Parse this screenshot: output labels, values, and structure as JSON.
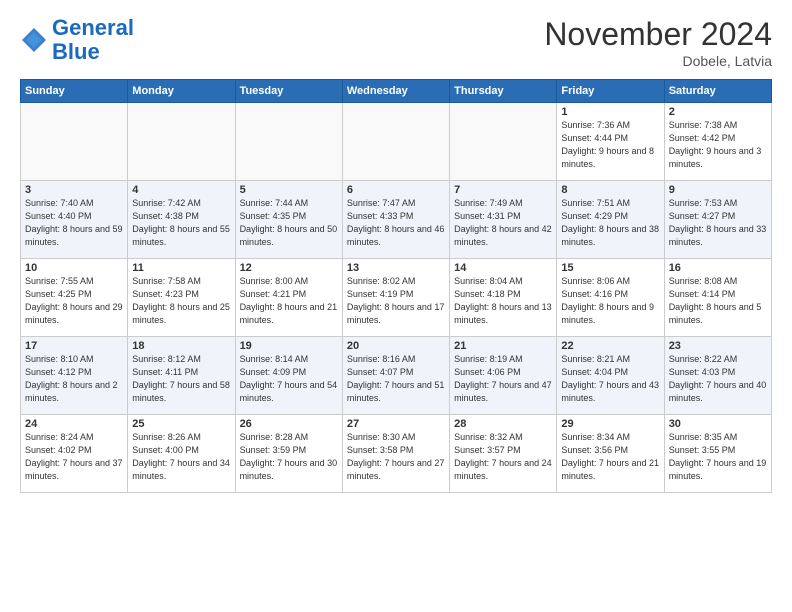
{
  "header": {
    "logo_line1": "General",
    "logo_line2": "Blue",
    "month_title": "November 2024",
    "location": "Dobele, Latvia"
  },
  "weekdays": [
    "Sunday",
    "Monday",
    "Tuesday",
    "Wednesday",
    "Thursday",
    "Friday",
    "Saturday"
  ],
  "weeks": [
    [
      {
        "day": "",
        "info": ""
      },
      {
        "day": "",
        "info": ""
      },
      {
        "day": "",
        "info": ""
      },
      {
        "day": "",
        "info": ""
      },
      {
        "day": "",
        "info": ""
      },
      {
        "day": "1",
        "info": "Sunrise: 7:36 AM\nSunset: 4:44 PM\nDaylight: 9 hours\nand 8 minutes."
      },
      {
        "day": "2",
        "info": "Sunrise: 7:38 AM\nSunset: 4:42 PM\nDaylight: 9 hours\nand 3 minutes."
      }
    ],
    [
      {
        "day": "3",
        "info": "Sunrise: 7:40 AM\nSunset: 4:40 PM\nDaylight: 8 hours\nand 59 minutes."
      },
      {
        "day": "4",
        "info": "Sunrise: 7:42 AM\nSunset: 4:38 PM\nDaylight: 8 hours\nand 55 minutes."
      },
      {
        "day": "5",
        "info": "Sunrise: 7:44 AM\nSunset: 4:35 PM\nDaylight: 8 hours\nand 50 minutes."
      },
      {
        "day": "6",
        "info": "Sunrise: 7:47 AM\nSunset: 4:33 PM\nDaylight: 8 hours\nand 46 minutes."
      },
      {
        "day": "7",
        "info": "Sunrise: 7:49 AM\nSunset: 4:31 PM\nDaylight: 8 hours\nand 42 minutes."
      },
      {
        "day": "8",
        "info": "Sunrise: 7:51 AM\nSunset: 4:29 PM\nDaylight: 8 hours\nand 38 minutes."
      },
      {
        "day": "9",
        "info": "Sunrise: 7:53 AM\nSunset: 4:27 PM\nDaylight: 8 hours\nand 33 minutes."
      }
    ],
    [
      {
        "day": "10",
        "info": "Sunrise: 7:55 AM\nSunset: 4:25 PM\nDaylight: 8 hours\nand 29 minutes."
      },
      {
        "day": "11",
        "info": "Sunrise: 7:58 AM\nSunset: 4:23 PM\nDaylight: 8 hours\nand 25 minutes."
      },
      {
        "day": "12",
        "info": "Sunrise: 8:00 AM\nSunset: 4:21 PM\nDaylight: 8 hours\nand 21 minutes."
      },
      {
        "day": "13",
        "info": "Sunrise: 8:02 AM\nSunset: 4:19 PM\nDaylight: 8 hours\nand 17 minutes."
      },
      {
        "day": "14",
        "info": "Sunrise: 8:04 AM\nSunset: 4:18 PM\nDaylight: 8 hours\nand 13 minutes."
      },
      {
        "day": "15",
        "info": "Sunrise: 8:06 AM\nSunset: 4:16 PM\nDaylight: 8 hours\nand 9 minutes."
      },
      {
        "day": "16",
        "info": "Sunrise: 8:08 AM\nSunset: 4:14 PM\nDaylight: 8 hours\nand 5 minutes."
      }
    ],
    [
      {
        "day": "17",
        "info": "Sunrise: 8:10 AM\nSunset: 4:12 PM\nDaylight: 8 hours\nand 2 minutes."
      },
      {
        "day": "18",
        "info": "Sunrise: 8:12 AM\nSunset: 4:11 PM\nDaylight: 7 hours\nand 58 minutes."
      },
      {
        "day": "19",
        "info": "Sunrise: 8:14 AM\nSunset: 4:09 PM\nDaylight: 7 hours\nand 54 minutes."
      },
      {
        "day": "20",
        "info": "Sunrise: 8:16 AM\nSunset: 4:07 PM\nDaylight: 7 hours\nand 51 minutes."
      },
      {
        "day": "21",
        "info": "Sunrise: 8:19 AM\nSunset: 4:06 PM\nDaylight: 7 hours\nand 47 minutes."
      },
      {
        "day": "22",
        "info": "Sunrise: 8:21 AM\nSunset: 4:04 PM\nDaylight: 7 hours\nand 43 minutes."
      },
      {
        "day": "23",
        "info": "Sunrise: 8:22 AM\nSunset: 4:03 PM\nDaylight: 7 hours\nand 40 minutes."
      }
    ],
    [
      {
        "day": "24",
        "info": "Sunrise: 8:24 AM\nSunset: 4:02 PM\nDaylight: 7 hours\nand 37 minutes."
      },
      {
        "day": "25",
        "info": "Sunrise: 8:26 AM\nSunset: 4:00 PM\nDaylight: 7 hours\nand 34 minutes."
      },
      {
        "day": "26",
        "info": "Sunrise: 8:28 AM\nSunset: 3:59 PM\nDaylight: 7 hours\nand 30 minutes."
      },
      {
        "day": "27",
        "info": "Sunrise: 8:30 AM\nSunset: 3:58 PM\nDaylight: 7 hours\nand 27 minutes."
      },
      {
        "day": "28",
        "info": "Sunrise: 8:32 AM\nSunset: 3:57 PM\nDaylight: 7 hours\nand 24 minutes."
      },
      {
        "day": "29",
        "info": "Sunrise: 8:34 AM\nSunset: 3:56 PM\nDaylight: 7 hours\nand 21 minutes."
      },
      {
        "day": "30",
        "info": "Sunrise: 8:35 AM\nSunset: 3:55 PM\nDaylight: 7 hours\nand 19 minutes."
      }
    ]
  ]
}
